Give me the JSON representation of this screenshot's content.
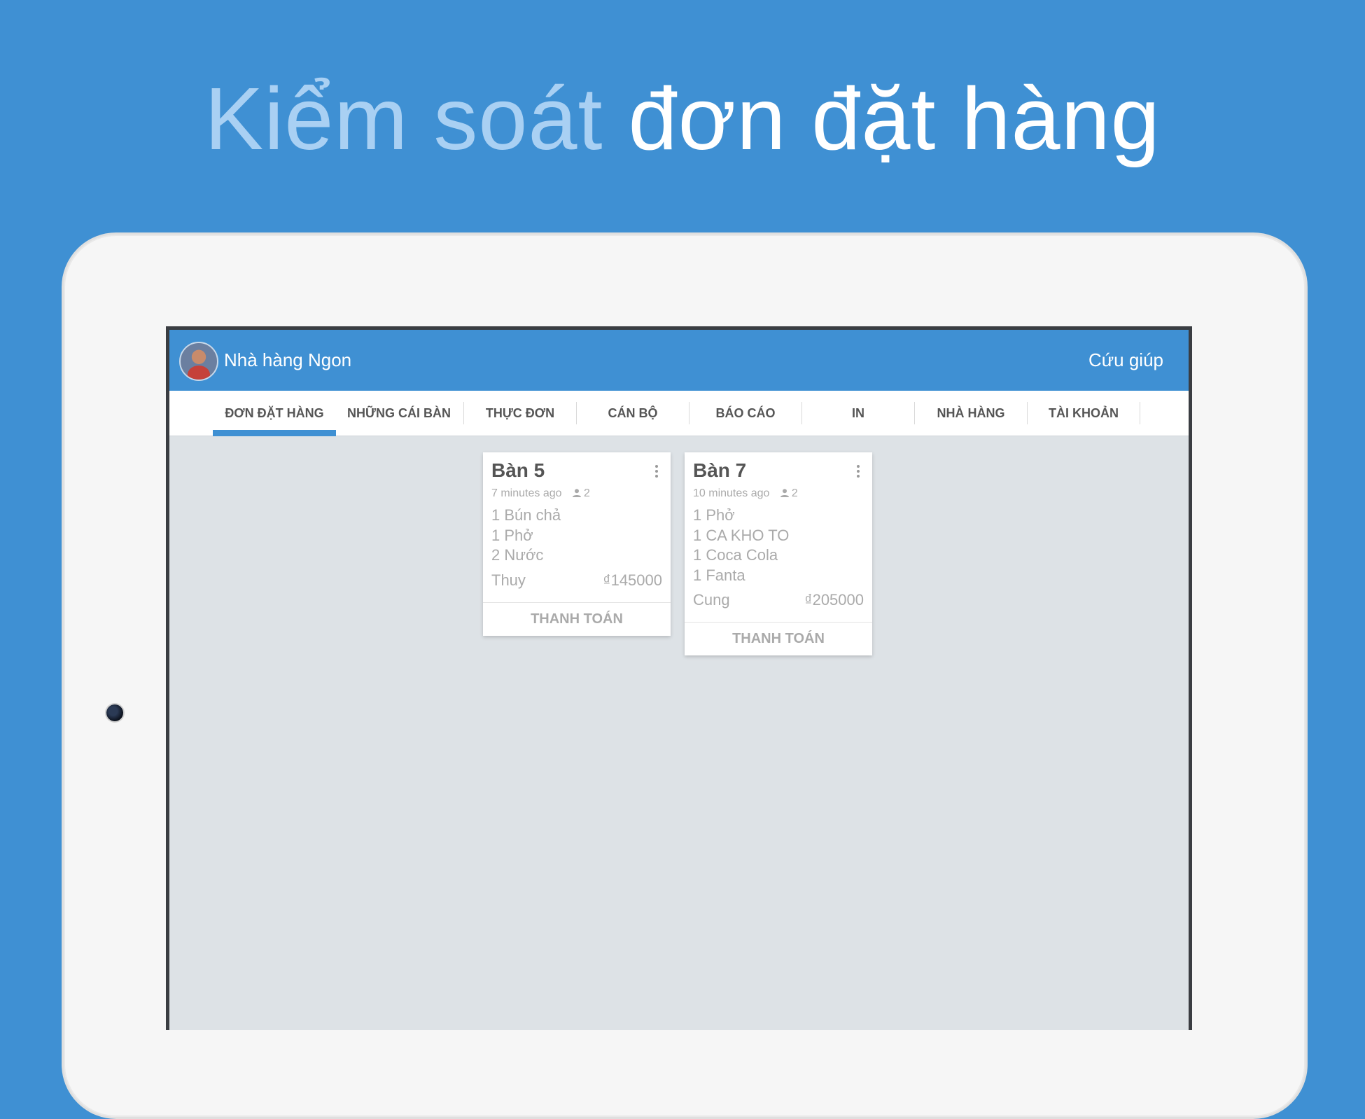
{
  "headline": {
    "part1": "Kiểm soát",
    "part2": "đơn đặt hàng"
  },
  "app": {
    "title": "Nhà hàng Ngon",
    "help": "Cứu giúp"
  },
  "tabs": [
    {
      "label": "ĐƠN ĐẶT HÀNG",
      "active": true
    },
    {
      "label": "NHỮNG CÁI BÀN"
    },
    {
      "label": "THỰC ĐƠN"
    },
    {
      "label": "CÁN BỘ"
    },
    {
      "label": "BÁO CÁO"
    },
    {
      "label": "IN"
    },
    {
      "label": "NHÀ HÀNG"
    },
    {
      "label": "TÀI KHOẢN"
    }
  ],
  "orders": [
    {
      "table": "Bàn 5",
      "time": "7 minutes ago",
      "guests": "2",
      "items": [
        "1 Bún chả",
        "1 Phở",
        "2 Nước"
      ],
      "staff": "Thuy",
      "total": "₫145000",
      "pay_label": "THANH TOÁN"
    },
    {
      "table": "Bàn 7",
      "time": "10 minutes ago",
      "guests": "2",
      "items": [
        "1 Phở",
        "1 CA KHO TO",
        "1 Coca Cola",
        "1 Fanta"
      ],
      "staff": "Cung",
      "total": "₫205000",
      "pay_label": "THANH TOÁN"
    }
  ],
  "icons": {
    "fab": "plus-icon",
    "card_menu": "more-vert-icon",
    "guests": "person-icon"
  },
  "colors": {
    "brand": "#3f90d3",
    "fab": "#5cb85c"
  }
}
